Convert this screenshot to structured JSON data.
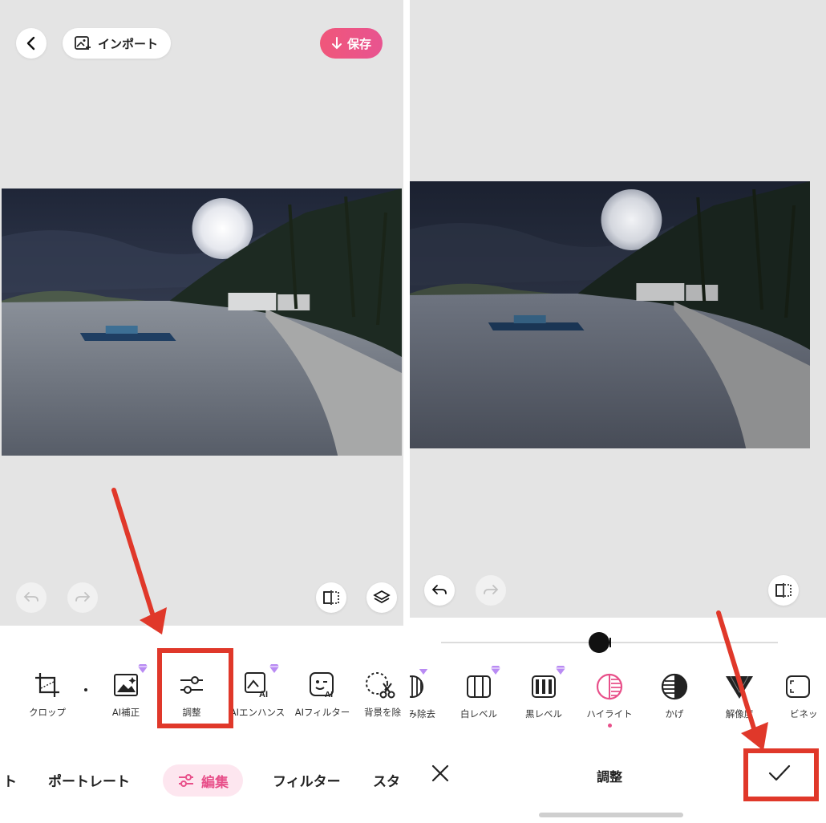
{
  "left": {
    "top_bar": {
      "import_label": "インポート",
      "save_label": "保存"
    },
    "tools": [
      {
        "label": "クロップ",
        "icon": "crop-icon",
        "premium": false
      },
      {
        "label": "AI補正",
        "icon": "ai-enhance-photo-icon",
        "premium": true
      },
      {
        "label": "調整",
        "icon": "sliders-icon",
        "premium": false
      },
      {
        "label": "AIエンハンス",
        "icon": "ai-enhance-icon",
        "premium": true
      },
      {
        "label": "AIフィルター",
        "icon": "ai-filter-icon",
        "premium": false
      },
      {
        "label": "背景を除",
        "icon": "scissors-icon",
        "premium": false
      }
    ],
    "tabs": {
      "partial_left": "ト",
      "portrait": "ポートレート",
      "edit": "編集",
      "filter": "フィルター",
      "partial_right": "スタ"
    }
  },
  "right": {
    "slider": {
      "value": 0.47
    },
    "adjustments": [
      {
        "label": "み除去",
        "icon": "haze-icon",
        "premium": true,
        "active": false
      },
      {
        "label": "白レベル",
        "icon": "white-level-icon",
        "premium": true,
        "active": false
      },
      {
        "label": "黒レベル",
        "icon": "black-level-icon",
        "premium": true,
        "active": false
      },
      {
        "label": "ハイライト",
        "icon": "highlight-icon",
        "premium": false,
        "active": true
      },
      {
        "label": "かげ",
        "icon": "shadow-icon",
        "premium": false,
        "active": false
      },
      {
        "label": "解像度",
        "icon": "resolution-icon",
        "premium": false,
        "active": false
      },
      {
        "label": "ビネッ",
        "icon": "vignette-icon",
        "premium": false,
        "active": false
      }
    ],
    "bottom": {
      "title": "調整"
    }
  },
  "colors": {
    "accent": "#e8508a",
    "annotation": "#e0382a",
    "canvas": "#e4e4e4"
  }
}
